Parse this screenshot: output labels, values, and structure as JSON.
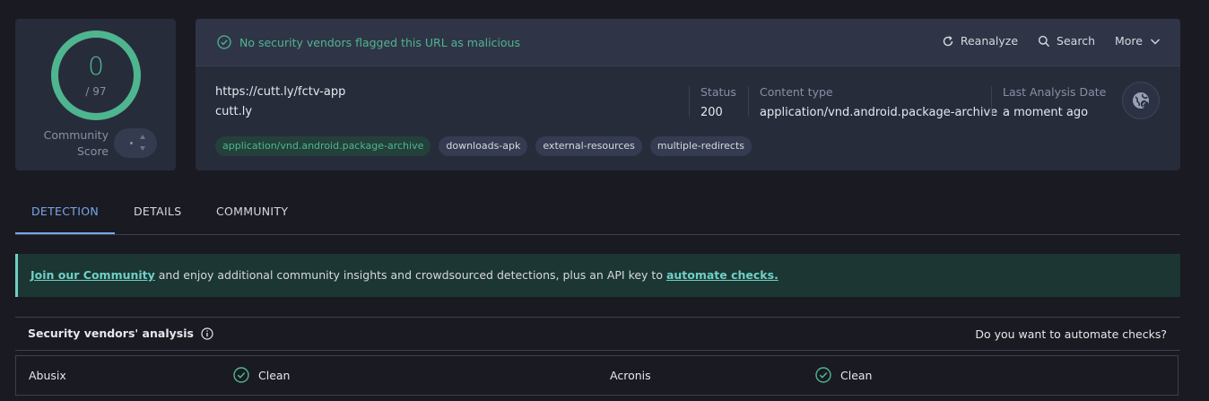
{
  "colors": {
    "background": "#1a1a22",
    "panel": "#272c3b",
    "accent_green": "#4fb58f",
    "accent_blue": "#7aa7e8",
    "banner_accent": "#6fd0c6"
  },
  "score": {
    "detections": "0",
    "total": "/ 97",
    "community_label_line1": "Community",
    "community_label_line2": "Score"
  },
  "header": {
    "verdict": "No security vendors flagged this URL as malicious",
    "verdict_icon": "check-circle-icon",
    "actions": [
      {
        "label": "Reanalyze",
        "icon": "refresh-icon"
      },
      {
        "label": "Search",
        "icon": "search-icon"
      },
      {
        "label": "More",
        "icon": "chevron-down-icon"
      }
    ]
  },
  "details": {
    "url": "https://cutt.ly/fctv-app",
    "domain": "cutt.ly",
    "status_label": "Status",
    "status_value": "200",
    "content_type_label": "Content type",
    "content_type_value": "application/vnd.android.package-archive",
    "last_analysis_label": "Last Analysis Date",
    "last_analysis_value": "a moment ago",
    "globe_icon": "globe-link-icon"
  },
  "tags": [
    "application/vnd.android.package-archive",
    "downloads-apk",
    "external-resources",
    "multiple-redirects"
  ],
  "tabs": [
    "DETECTION",
    "DETAILS",
    "COMMUNITY"
  ],
  "active_tab": "DETECTION",
  "banner": {
    "link1": "Join our Community",
    "middle": " and enjoy additional community insights and crowdsourced detections, plus an API key to ",
    "link2": "automate checks."
  },
  "vendors": {
    "title": "Security vendors' analysis",
    "info_icon": "info-icon",
    "automate_question": "Do you want to automate checks?",
    "rows": [
      {
        "left_name": "Abusix",
        "left_result": "Clean",
        "right_name": "Acronis",
        "right_result": "Clean"
      }
    ]
  }
}
